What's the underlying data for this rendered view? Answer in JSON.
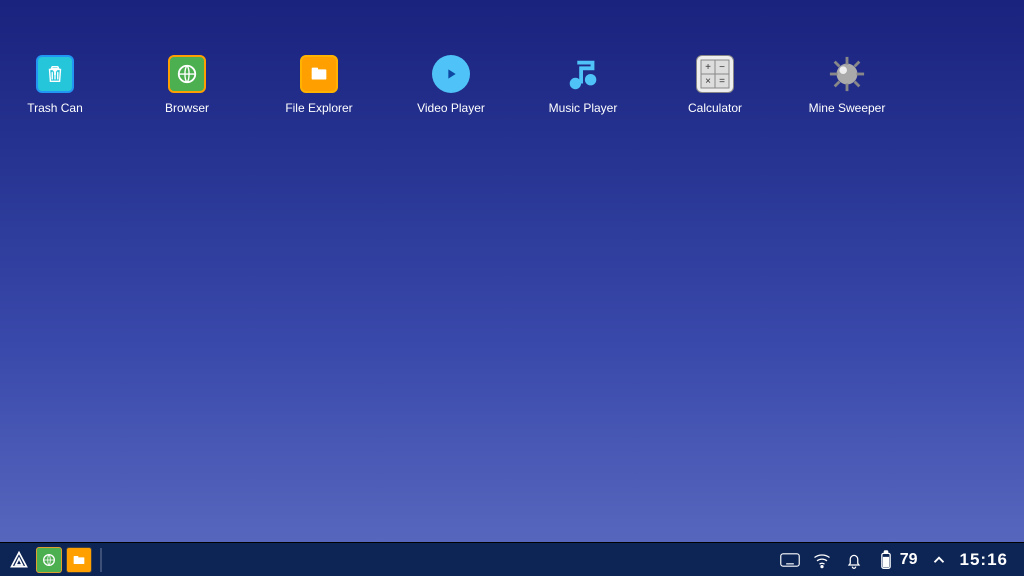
{
  "desktop": {
    "icons": [
      {
        "label": "Trash Can",
        "name": "trash-can-icon"
      },
      {
        "label": "Browser",
        "name": "browser-icon"
      },
      {
        "label": "File Explorer",
        "name": "file-explorer-icon"
      },
      {
        "label": "Video Player",
        "name": "video-player-icon"
      },
      {
        "label": "Music Player",
        "name": "music-player-icon"
      },
      {
        "label": "Calculator",
        "name": "calculator-icon"
      },
      {
        "label": "Mine Sweeper",
        "name": "mine-sweeper-icon"
      }
    ]
  },
  "taskbar": {
    "start": "Start",
    "pinned": [
      {
        "name": "browser-pinned"
      },
      {
        "name": "file-explorer-pinned"
      }
    ],
    "tray": {
      "keyboard": "Keyboard",
      "wifi": "Wi-Fi",
      "notifications": "Notifications",
      "battery_level": "79",
      "expand": "Show hidden icons",
      "clock": "15:16"
    }
  }
}
